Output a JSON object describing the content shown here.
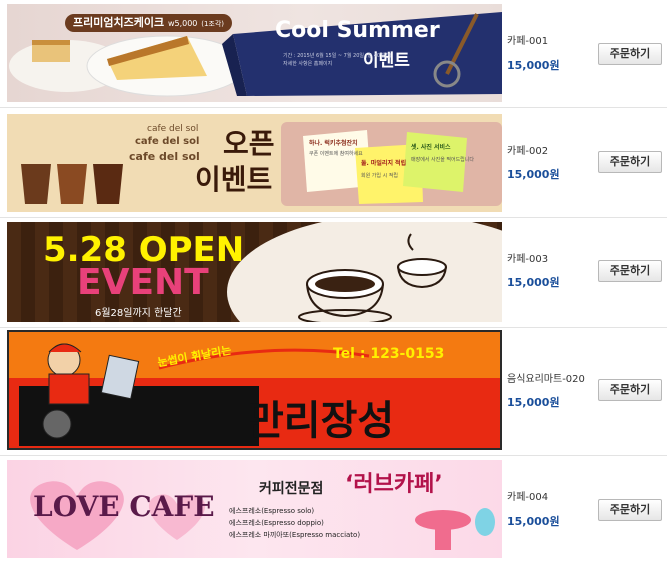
{
  "products": [
    {
      "code": "카페-001",
      "price": "15,000원",
      "order_label": "주문하기",
      "banner": {
        "tag": "프리미엄치즈케이크",
        "tag_price": "w5,000",
        "tag_note": "(1조각)",
        "title_line1": "Cool Summer",
        "title_line2": "이벤트",
        "detail": "기간 : 2015년 6월 15일 ~ 7월 20일 (총 40일간)",
        "detail2": "자세한 사항은 홈페이지"
      }
    },
    {
      "code": "카페-002",
      "price": "15,000원",
      "order_label": "주문하기",
      "banner": {
        "brand1": "cafe del sol",
        "brand2": "cafe del sol",
        "brand3": "cafe del sol",
        "title_line1": "오픈",
        "title_line2": "이벤트",
        "note1_title": "하나. 럭키추첨잔치",
        "note1_body": "쿠폰 이벤트에 참여하세요",
        "note2_title": "둘. 마일리지 적립",
        "note2_body": "회원 가입 시 적립",
        "note3_title": "셋. 사진 서비스",
        "note3_body": "매장에서 사진을 찍어드립니다"
      }
    },
    {
      "code": "카페-003",
      "price": "15,000원",
      "order_label": "주문하기",
      "banner": {
        "title_line1": "5.28 OPEN",
        "title_line2": "EVENT",
        "subtitle": "6월28일까지 한달간"
      }
    },
    {
      "code": "음식요리마트-020",
      "price": "15,000원",
      "order_label": "주문하기",
      "banner": {
        "slogan": "눈썹이 휘날리는",
        "phone": "Tel : 123-0153",
        "title": "만리장성"
      }
    },
    {
      "code": "카페-004",
      "price": "15,000원",
      "order_label": "주문하기",
      "banner": {
        "title": "LOVE CAFE",
        "heading": "커피전문점",
        "name": "‘러브카페’",
        "menu": [
          "에스프레소(Espresso solo)",
          "에스프레소(Espresso doppio)",
          "에스프레소 마끼아또(Espresso macciato)"
        ]
      }
    }
  ]
}
